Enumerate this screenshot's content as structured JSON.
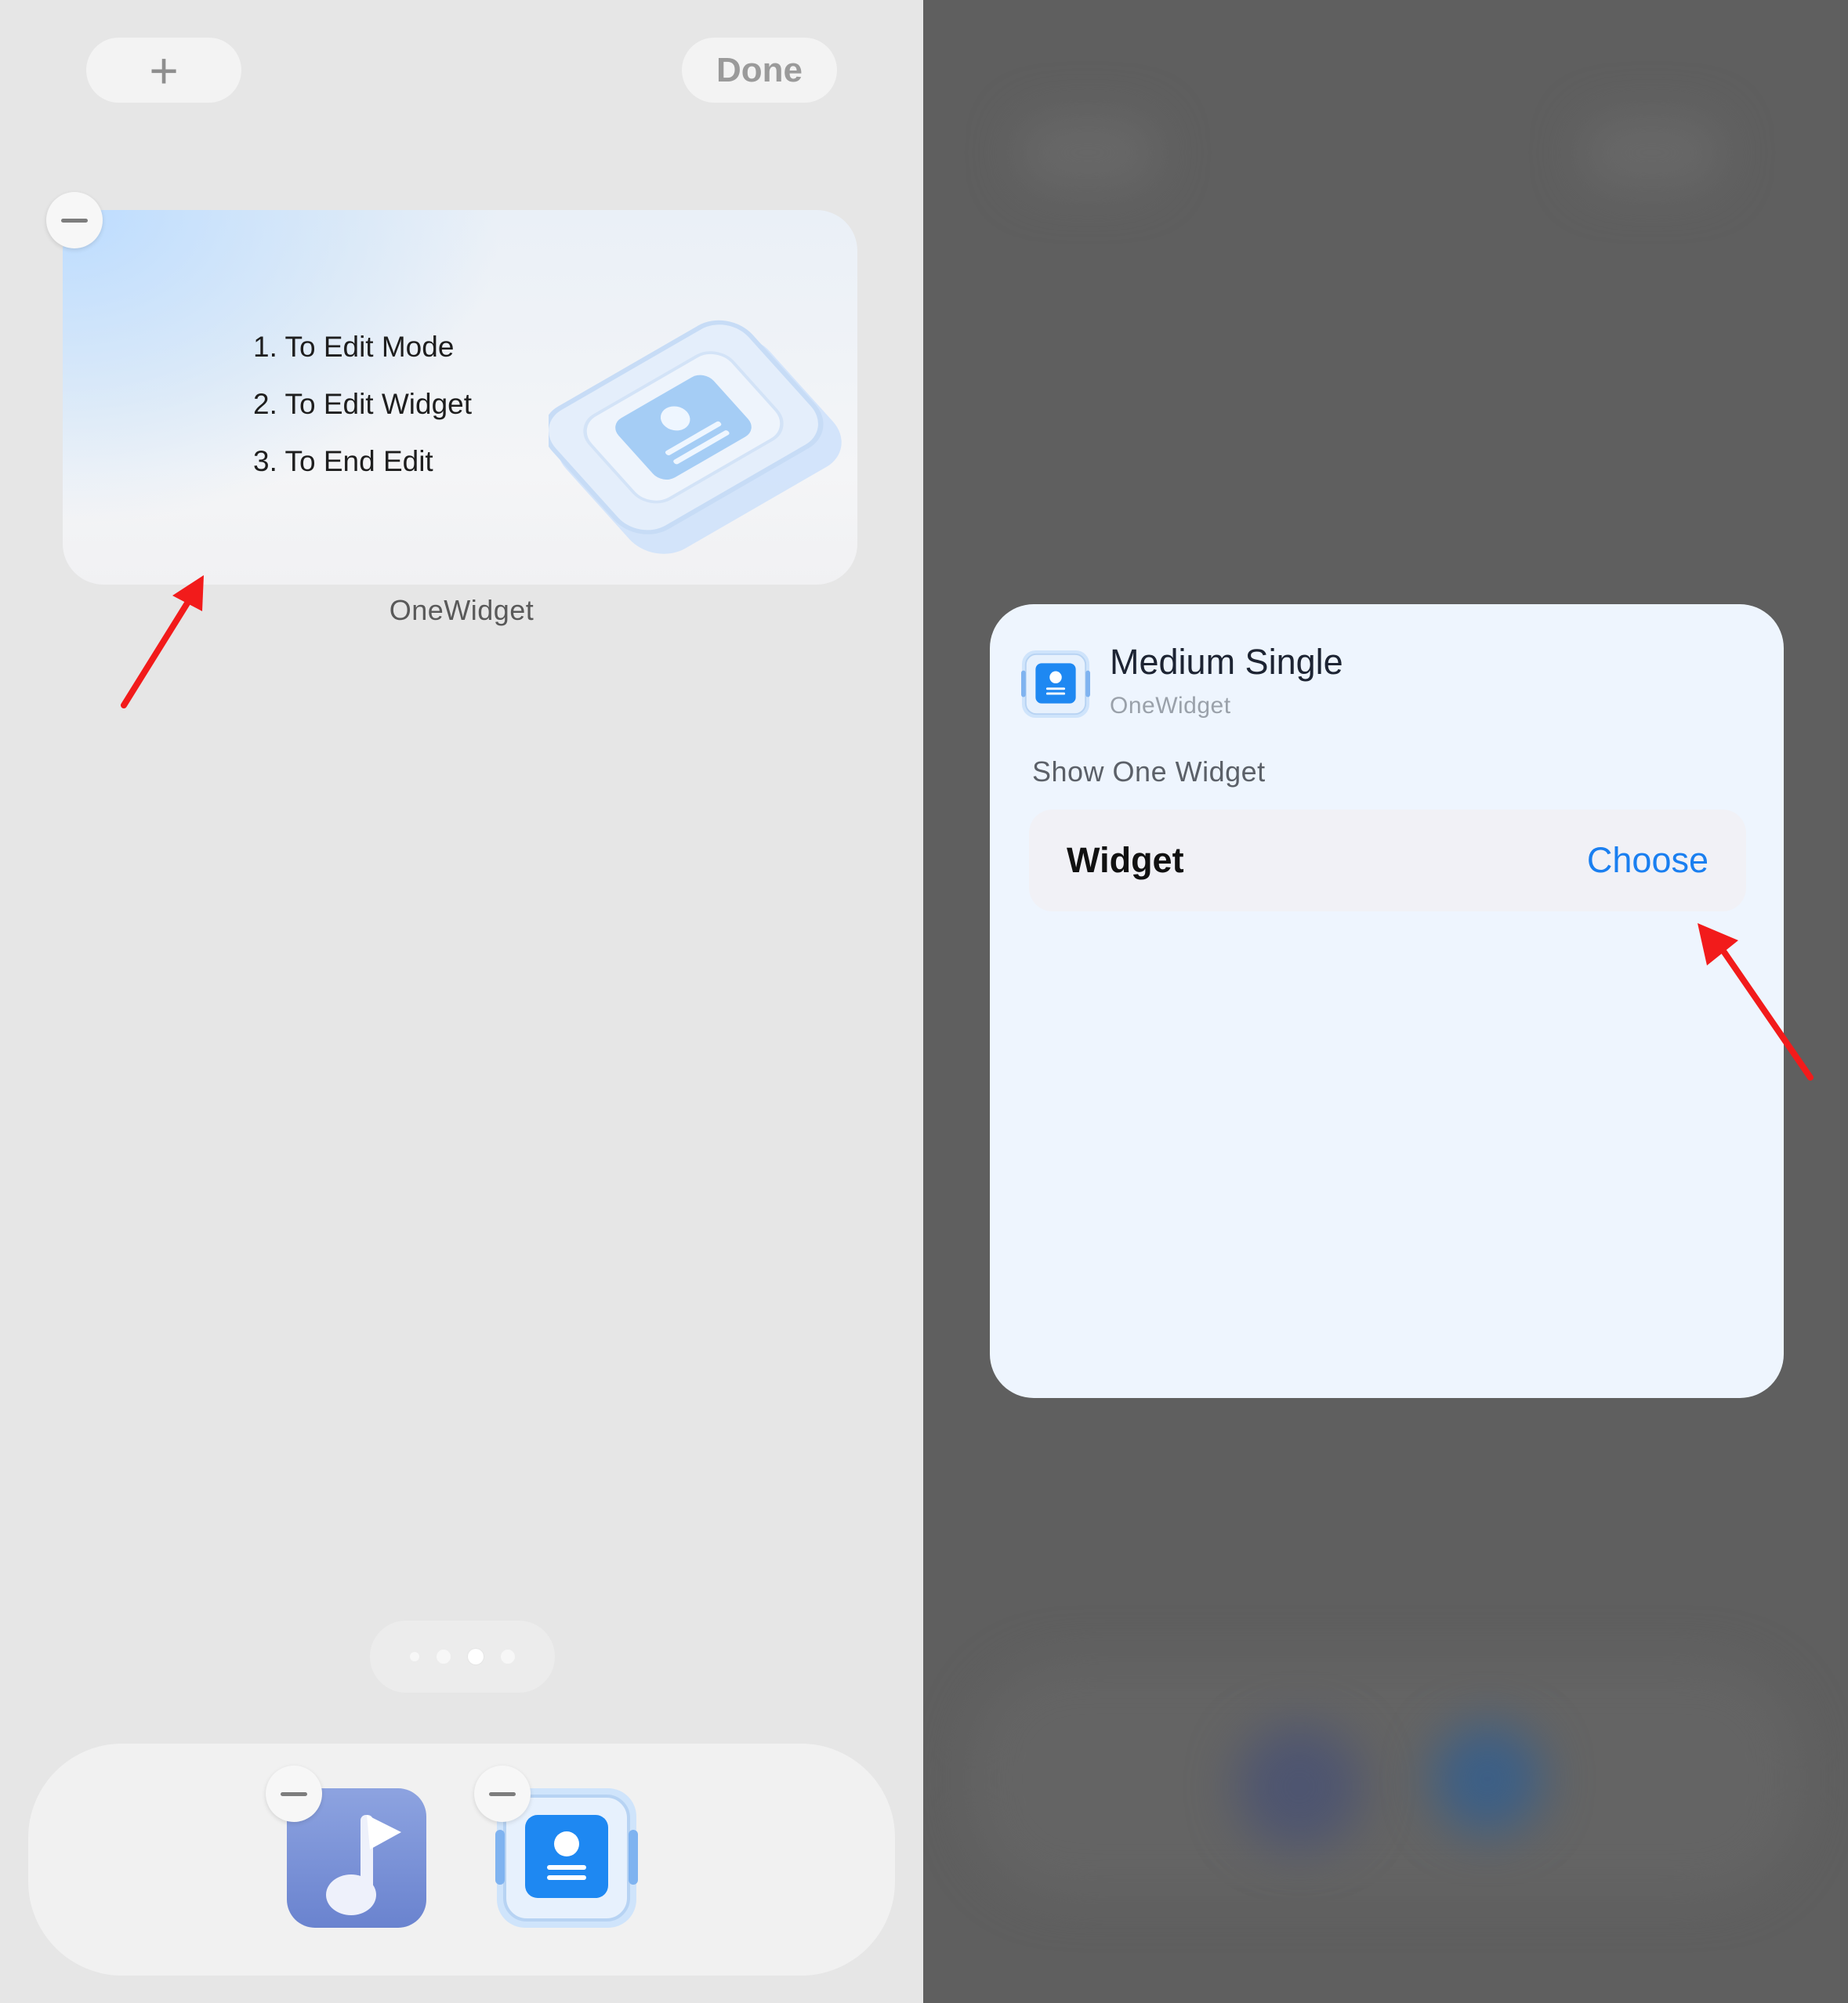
{
  "home_edit": {
    "add_label": "+",
    "done_label": "Done",
    "widget": {
      "steps": [
        "1. To Edit Mode",
        "2. To Edit Widget",
        "3. To End Edit"
      ],
      "name": "OneWidget"
    },
    "page_indicator": {
      "pages": 4,
      "current": 3
    },
    "dock_apps": [
      "music-app-icon",
      "onewidget-app-icon"
    ]
  },
  "config_sheet": {
    "title": "Medium Single",
    "subtitle": "OneWidget",
    "description": "Show One Widget",
    "parameter": {
      "label": "Widget",
      "action": "Choose"
    }
  },
  "colors": {
    "accent_blue": "#1a7ff0",
    "annotation_red": "#f21b1b",
    "left_background": "#e6e6e6",
    "dim_overlay": "#5f5f5f"
  }
}
